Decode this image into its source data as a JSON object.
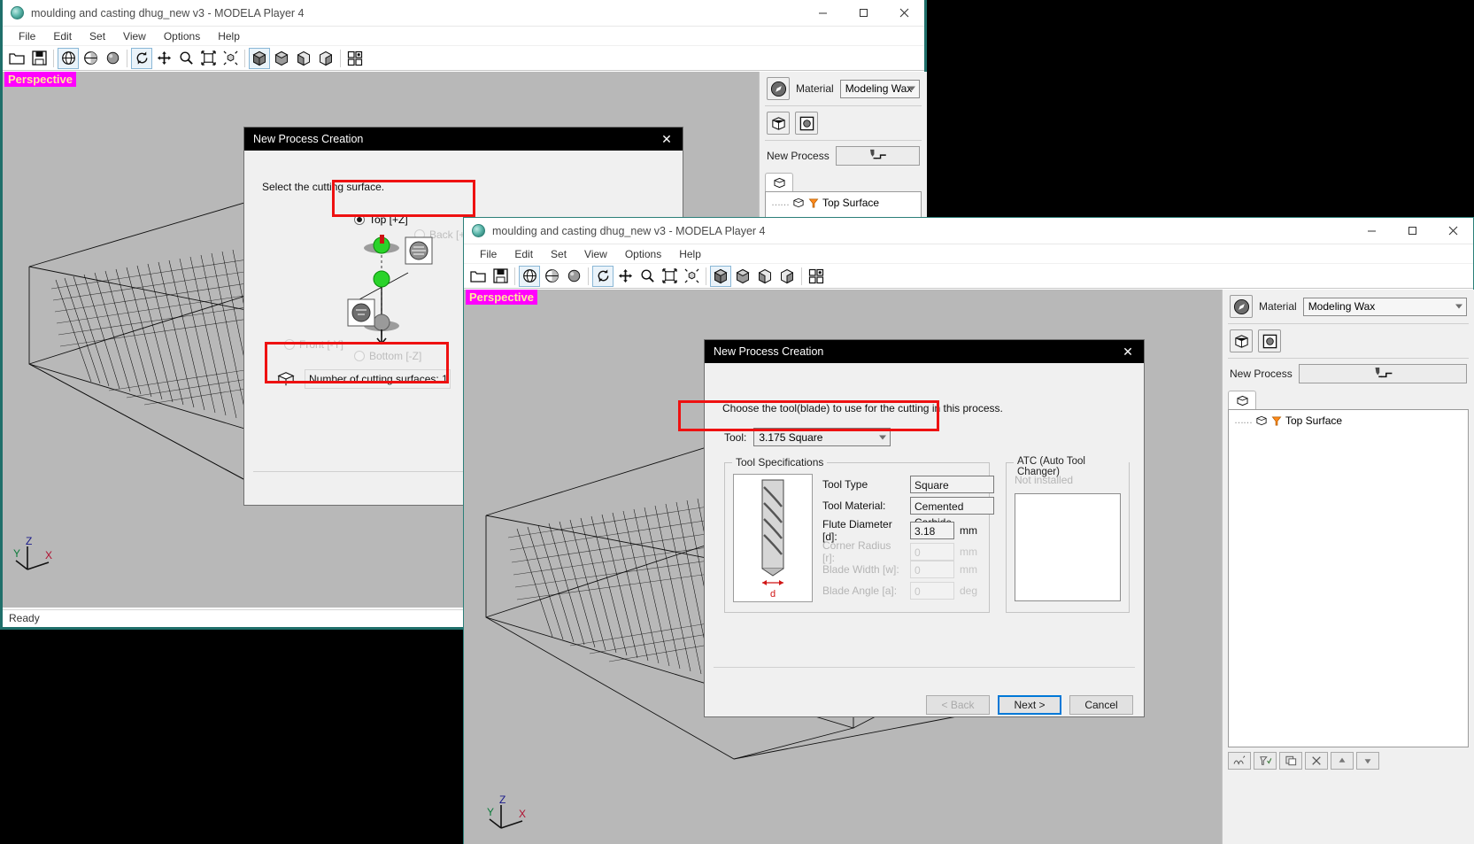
{
  "window1": {
    "title": "moulding and casting  dhug_new v3 - MODELA Player 4",
    "menu": [
      "File",
      "Edit",
      "Set",
      "View",
      "Options",
      "Help"
    ],
    "toolbar_icons": [
      "open-folder-icon",
      "save-disk-icon",
      "globe-wire-icon",
      "globe-half-icon",
      "sphere-solid-icon",
      "rotate-icon",
      "pan-move-icon",
      "zoom-magnifier-icon",
      "fit-view-icon",
      "zoom-box-icon",
      "cube-shaded-icon",
      "cube-solid-icon",
      "cube-left-icon",
      "cube-right-icon",
      "grid-view-icon"
    ],
    "viewport_tag": "Perspective",
    "status": "Ready",
    "axis": {
      "x": "X",
      "y": "Y",
      "z": "Z"
    },
    "min_label": "–",
    "max_label": "□",
    "close_label": "✕"
  },
  "window1_panel": {
    "material_label": "Material",
    "material_value": "Modeling Wax",
    "new_process_label": "New Process",
    "tree_item": "Top Surface",
    "icons": [
      "material-compass-icon",
      "model-cube-icon",
      "surface-target-icon",
      "new-process-tool-icon",
      "model-tab-icon",
      "process-cube-icon",
      "cutting-tool-icon"
    ]
  },
  "window2": {
    "title": "moulding and casting  dhug_new v3 - MODELA Player 4",
    "menu": [
      "File",
      "Edit",
      "Set",
      "View",
      "Options",
      "Help"
    ],
    "viewport_tag": "Perspective",
    "axis": {
      "x": "X",
      "y": "Y",
      "z": "Z"
    },
    "min_label": "–",
    "max_label": "□",
    "close_label": "✕"
  },
  "window2_panel": {
    "material_label": "Material",
    "material_value": "Modeling Wax",
    "new_process_label": "New Process",
    "tree_item": "Top Surface",
    "bottom_buttons": [
      "cutting-params-icon",
      "tool-select-icon",
      "copy-process-icon",
      "delete-process-icon",
      "move-up-icon",
      "move-down-icon"
    ]
  },
  "dialog1": {
    "title": "New Process Creation",
    "close_label": "✕",
    "instruction": "Select the cutting surface.",
    "options": [
      {
        "label": "Top [+Z]",
        "selected": true,
        "enabled": true
      },
      {
        "label": "Back [+Y]",
        "selected": false,
        "enabled": false
      },
      {
        "label": "Front [-Y]",
        "selected": false,
        "enabled": false
      },
      {
        "label": "Bottom [-Z]",
        "selected": false,
        "enabled": false
      }
    ],
    "surfaces_text": "Number of cutting surfaces: 1",
    "surfaces_icon": "cutting-surface-icon"
  },
  "dialog2": {
    "title": "New Process Creation",
    "close_label": "✕",
    "instruction": "Choose the tool(blade) to use for the cutting in this process.",
    "tool_label": "Tool:",
    "tool_value": "3.175 Square",
    "specs_legend": "Tool Specifications",
    "specs": [
      {
        "label": "Tool Type",
        "value": "Square",
        "unit": "",
        "enabled": true
      },
      {
        "label": "Tool Material:",
        "value": "Cemented Carbide",
        "unit": "",
        "enabled": true
      },
      {
        "label": "Flute Diameter [d]:",
        "value": "3.18",
        "unit": "mm",
        "enabled": true
      },
      {
        "label": "Corner Radius [r]:",
        "value": "0",
        "unit": "mm",
        "enabled": false
      },
      {
        "label": "Blade Width [w]:",
        "value": "0",
        "unit": "mm",
        "enabled": false
      },
      {
        "label": "Blade Angle [a]:",
        "value": "0",
        "unit": "deg",
        "enabled": false
      }
    ],
    "tool_diagram_label": "d",
    "atc_legend": "ATC (Auto Tool Changer)",
    "atc_status": "Not installed",
    "buttons": [
      {
        "label": "< Back",
        "kind": "dim"
      },
      {
        "label": "Next >",
        "kind": "primary"
      },
      {
        "label": "Cancel",
        "kind": "normal"
      }
    ]
  },
  "colors": {
    "accent_magenta": "#ff00ff",
    "highlight_red": "#ee1111",
    "focus_blue": "#0078d7",
    "viewport_gray": "#b8b8b8"
  }
}
